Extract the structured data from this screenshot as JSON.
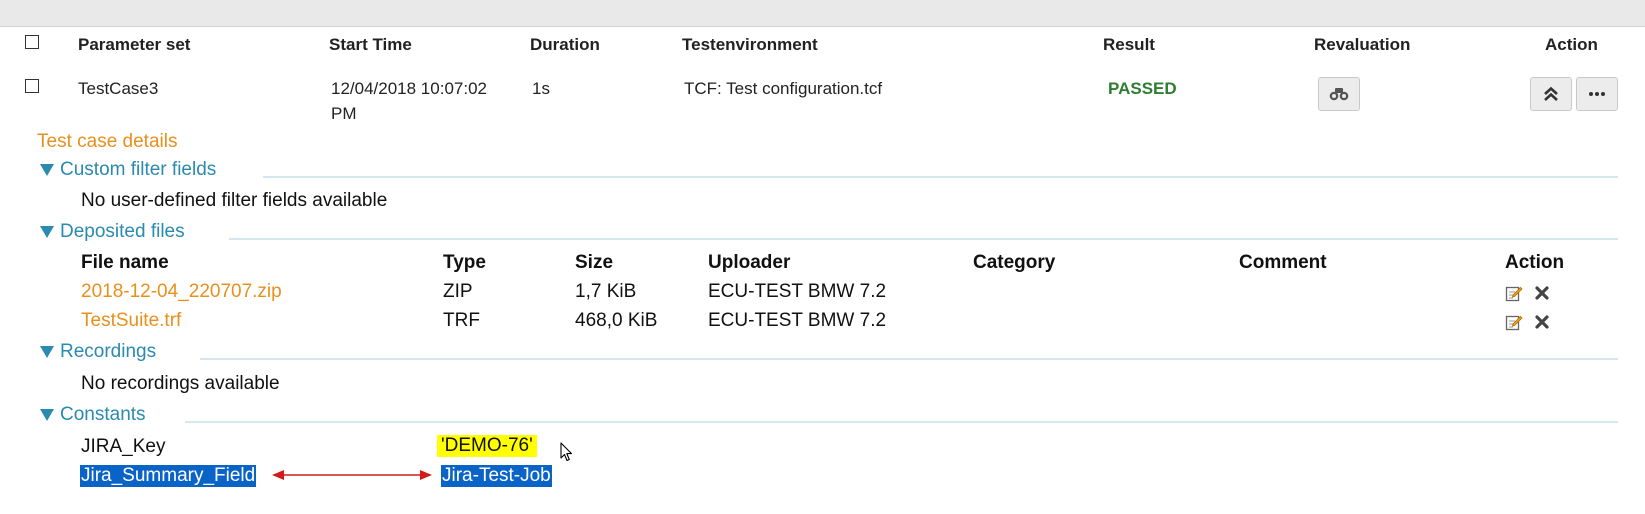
{
  "header": {
    "parameter_set": "Parameter set",
    "start_time": "Start Time",
    "duration": "Duration",
    "testenvironment": "Testenvironment",
    "result": "Result",
    "revaluation": "Revaluation",
    "action": "Action"
  },
  "row": {
    "parameter_set": "TestCase3",
    "start_time_line1": "12/04/2018 10:07:02",
    "start_time_line2": "PM",
    "duration": "1s",
    "testenvironment": "TCF: Test configuration.tcf",
    "result": "PASSED",
    "result_color": "#2e7d32"
  },
  "details": {
    "title": "Test case details",
    "custom_filter": {
      "title": "Custom filter fields",
      "empty": "No user-defined filter fields available"
    },
    "deposited_files": {
      "title": "Deposited files",
      "columns": [
        "File name",
        "Type",
        "Size",
        "Uploader",
        "Category",
        "Comment",
        "Action"
      ],
      "rows": [
        {
          "name": "2018-12-04_220707.zip",
          "type": "ZIP",
          "size": "1,7 KiB",
          "uploader": "ECU-TEST BMW 7.2",
          "category": "",
          "comment": ""
        },
        {
          "name": "TestSuite.trf",
          "type": "TRF",
          "size": "468,0 KiB",
          "uploader": "ECU-TEST BMW 7.2",
          "category": "",
          "comment": ""
        }
      ]
    },
    "recordings": {
      "title": "Recordings",
      "empty": "No recordings available"
    },
    "constants": {
      "title": "Constants",
      "items": [
        {
          "key": "JIRA_Key",
          "value": "'DEMO-76'"
        },
        {
          "key": "Jira_Summary_Field",
          "value": "Jira-Test-Job"
        }
      ]
    }
  },
  "colors": {
    "accent_orange": "#e8901c",
    "section_blue": "#2a8ab0",
    "passed_green": "#2e7d32",
    "highlight_yellow": "#ffff00",
    "selection_blue": "#0a64c8",
    "arrow_red": "#d11a1a"
  },
  "icons": {
    "revaluation": "binoculars-icon",
    "collapse": "double-chevron-up-icon",
    "more": "ellipsis-icon",
    "edit": "edit-icon",
    "delete": "close-icon",
    "section_toggle": "triangle-down-icon",
    "cursor": "mouse-pointer-icon"
  }
}
